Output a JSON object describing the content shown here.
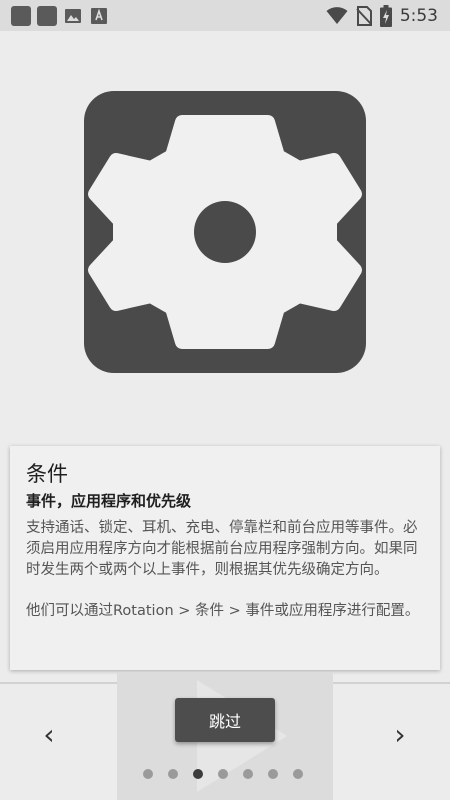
{
  "status_bar": {
    "time": "5:53",
    "icons": [
      "app-square-icon",
      "app-square-icon",
      "image-icon",
      "text-a-icon",
      "wifi-icon",
      "no-sim-icon",
      "battery-charging-icon"
    ]
  },
  "hero": {
    "icon": "gear-icon",
    "background": "#4a4a4a"
  },
  "card": {
    "title": "条件",
    "subtitle": "事件，应用程序和优先级",
    "paragraph1": "支持通话、锁定、耳机、充电、停靠栏和前台应用等事件。必须启用应用程序方向才能根据前台应用程序强制方向。如果同时发生两个或两个以上事件，则根据其优先级确定方向。",
    "paragraph2": "他们可以通过Rotation > 条件 > 事件或应用程序进行配置。"
  },
  "navigation": {
    "prev_symbol": "‹",
    "next_symbol": "›",
    "skip_label": "跳过",
    "page_count": 7,
    "current_page": 3
  }
}
